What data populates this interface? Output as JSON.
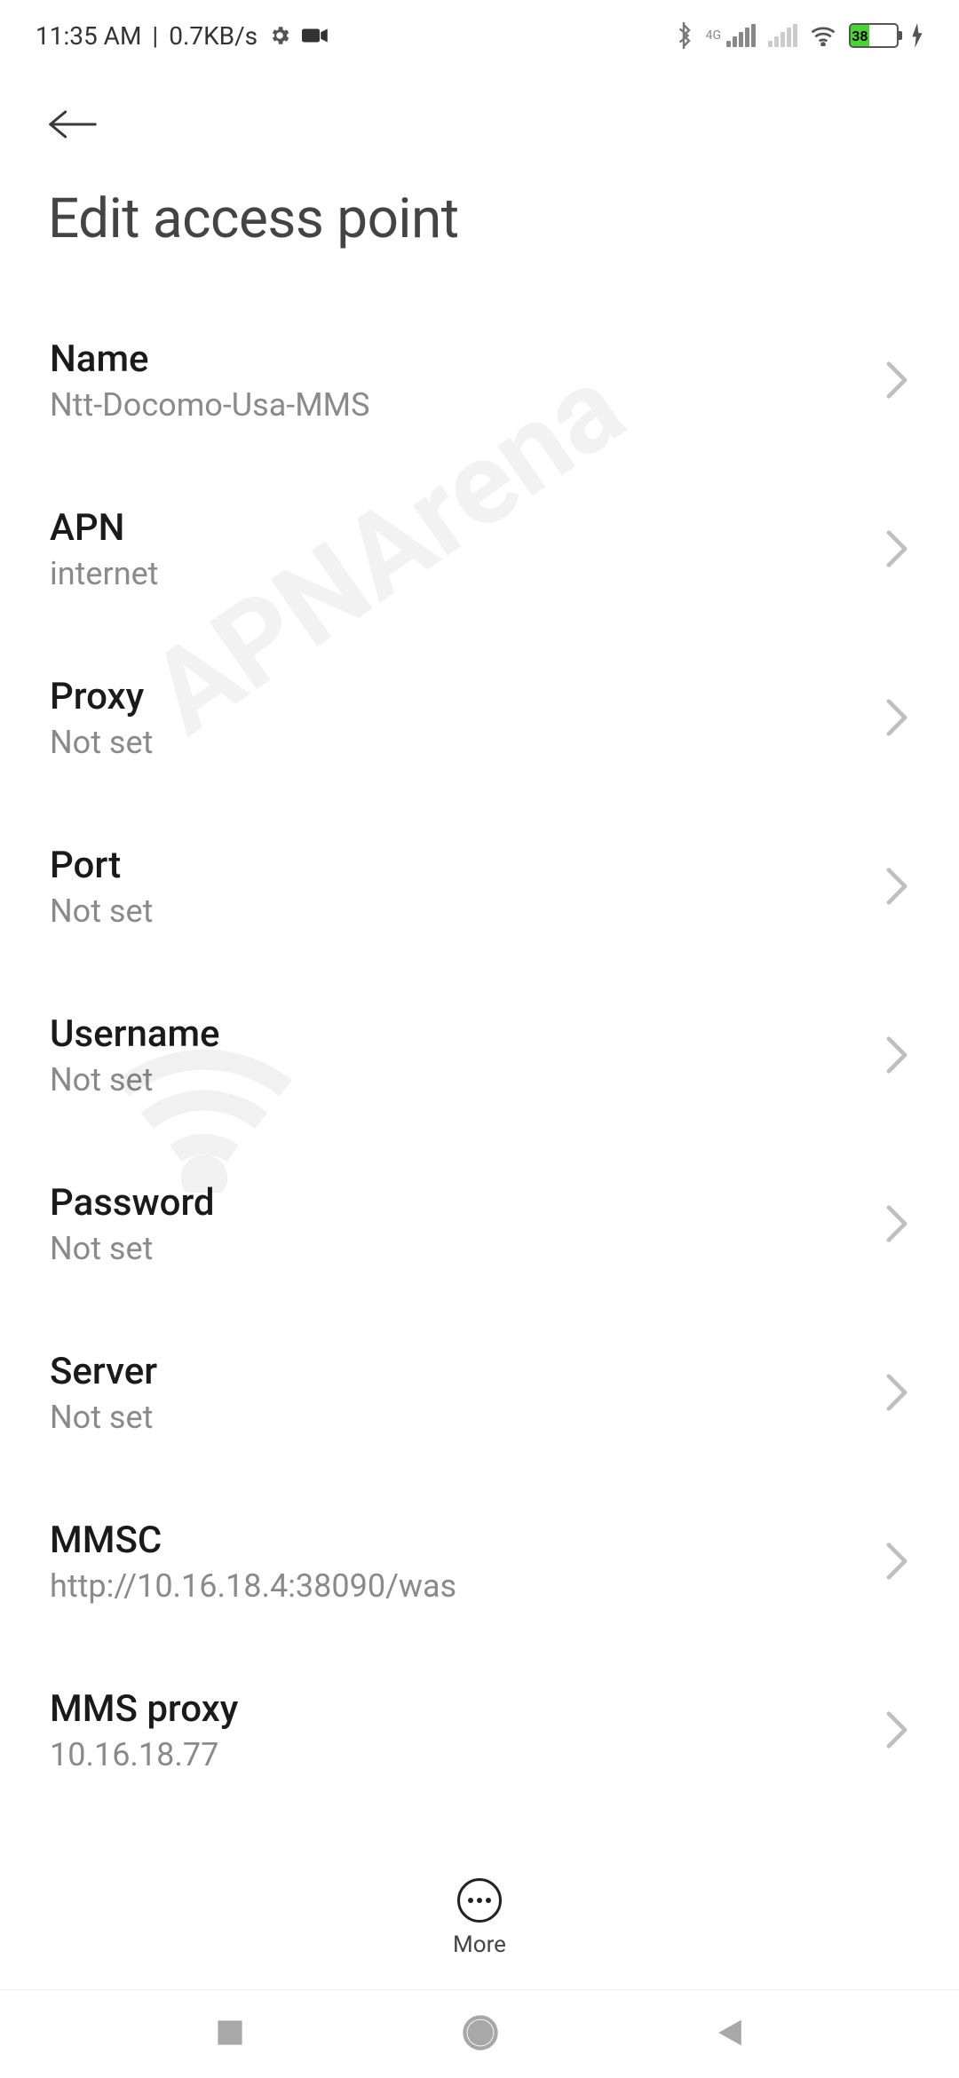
{
  "status": {
    "time": "11:35 AM",
    "speed": "0.7KB/s",
    "battery_pct": "38"
  },
  "header": {
    "title": "Edit access point"
  },
  "watermark": "APNArena",
  "fields": [
    {
      "label": "Name",
      "value": "Ntt-Docomo-Usa-MMS"
    },
    {
      "label": "APN",
      "value": "internet"
    },
    {
      "label": "Proxy",
      "value": "Not set"
    },
    {
      "label": "Port",
      "value": "Not set"
    },
    {
      "label": "Username",
      "value": "Not set"
    },
    {
      "label": "Password",
      "value": "Not set"
    },
    {
      "label": "Server",
      "value": "Not set"
    },
    {
      "label": "MMSC",
      "value": "http://10.16.18.4:38090/was"
    },
    {
      "label": "MMS proxy",
      "value": "10.16.18.77"
    }
  ],
  "footer": {
    "more_label": "More"
  }
}
